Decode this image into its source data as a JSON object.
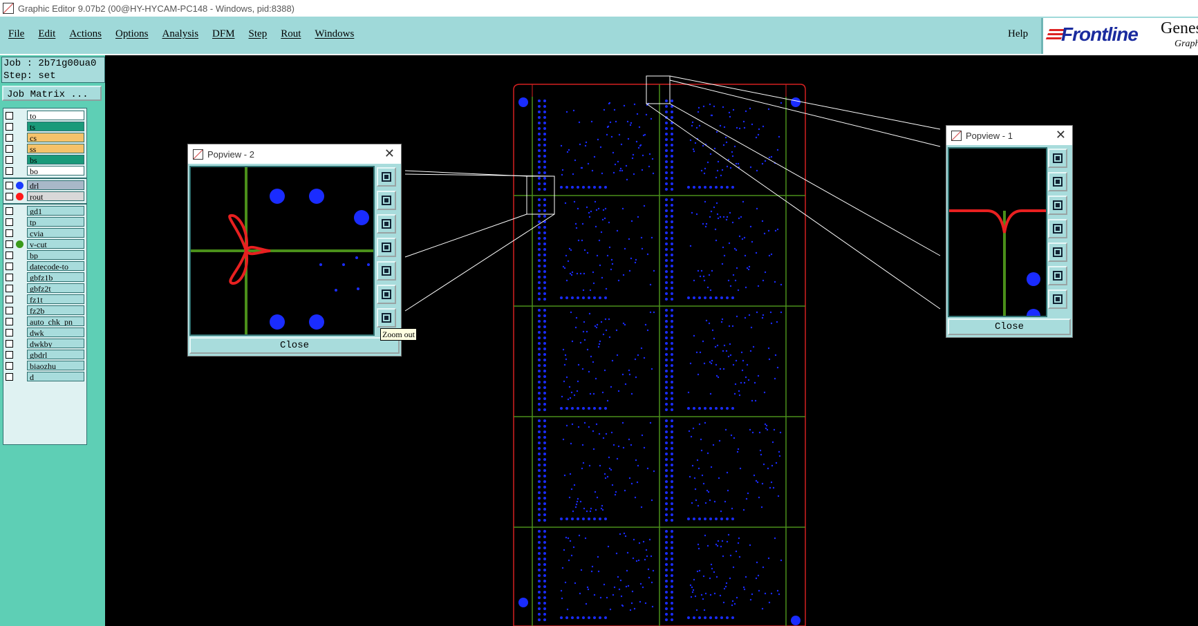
{
  "window": {
    "title": "Graphic Editor 9.07b2 (00@HY-HYCAM-PC148 - Windows, pid:8388)"
  },
  "menu": {
    "items": [
      "File",
      "Edit",
      "Actions",
      "Options",
      "Analysis",
      "DFM",
      "Step",
      "Rout",
      "Windows"
    ],
    "help": "Help"
  },
  "logo": {
    "brand": "Frontline",
    "product": "Genes",
    "sub": "Graph"
  },
  "job": {
    "job_line": "Job : 2b71g00ua0",
    "step_line": "Step: set",
    "matrix_button": "Job Matrix ..."
  },
  "layers": [
    {
      "name": "to",
      "color": "#ffffff"
    },
    {
      "name": "ts",
      "color": "#1a9a7a"
    },
    {
      "name": "cs",
      "color": "#f5c26a"
    },
    {
      "name": "ss",
      "color": "#f5c26a"
    },
    {
      "name": "bs",
      "color": "#1a9a7a"
    },
    {
      "name": "bo",
      "color": "#ffffff"
    },
    {
      "name": "drl",
      "color": "#a8b8c8",
      "dot": "#1a3cff"
    },
    {
      "name": "rout",
      "color": "#d8d8d8",
      "dot": "#ff1a1a"
    },
    {
      "name": "gd1",
      "color": "#a8dcdc"
    },
    {
      "name": "tp",
      "color": "#a8dcdc"
    },
    {
      "name": "cvia",
      "color": "#a8dcdc"
    },
    {
      "name": "v-cut",
      "color": "#a8dcdc",
      "dot": "#3a9a1a"
    },
    {
      "name": "bp",
      "color": "#a8dcdc"
    },
    {
      "name": "datecode-to",
      "color": "#a8dcdc"
    },
    {
      "name": "gbfz1b",
      "color": "#a8dcdc"
    },
    {
      "name": "gbfz2t",
      "color": "#a8dcdc"
    },
    {
      "name": "fz1t",
      "color": "#a8dcdc"
    },
    {
      "name": "fz2b",
      "color": "#a8dcdc"
    },
    {
      "name": "auto_chk_pn",
      "color": "#a8dcdc"
    },
    {
      "name": "dwk",
      "color": "#a8dcdc"
    },
    {
      "name": "dwkby",
      "color": "#a8dcdc"
    },
    {
      "name": "gbdrl",
      "color": "#a8dcdc"
    },
    {
      "name": "biaozhu",
      "color": "#a8dcdc"
    },
    {
      "name": "d",
      "color": "#a8dcdc"
    }
  ],
  "popview2": {
    "title": "Popview - 2",
    "close": "Close",
    "tooltip": "Zoom out"
  },
  "popview1": {
    "title": "Popview - 1",
    "close": "Close"
  },
  "colors": {
    "outline": "#d42020",
    "vcut": "#4a8f1a",
    "drill": "#1a2cff",
    "menu_bg": "#9fd9d9",
    "side_bg": "#5ecfb5"
  }
}
